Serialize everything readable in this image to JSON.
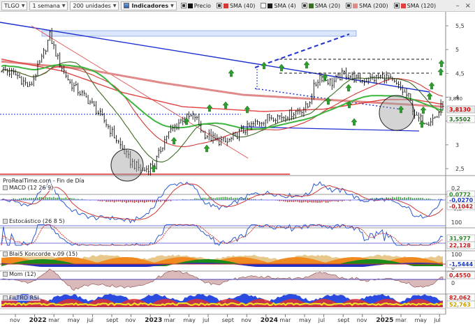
{
  "toolbar": {
    "symbol": "TLGO",
    "timeframe": "1 semana",
    "units": "200 unidades",
    "indicators_label": "Indicadores",
    "legend": [
      {
        "label": "Precio",
        "color": "#111111",
        "checked": true
      },
      {
        "label": "SMA (40)",
        "color": "#d23a3a",
        "checked": true
      },
      {
        "label": "SMA (4)",
        "color": "#1a1a1a",
        "checked": false
      },
      {
        "label": "SMA (20)",
        "color": "#3e6b25",
        "checked": true
      },
      {
        "label": "SMA (200)",
        "color": "#e08a8a",
        "checked": true
      },
      {
        "label": "SMA (120)",
        "color": "#e04040",
        "checked": true
      }
    ]
  },
  "main": {
    "watermark": "ProRealTime.com - Fin de Día",
    "price_axis": [
      "5,5",
      "5",
      "4,5",
      "4",
      "3,5",
      "3",
      "2,5"
    ],
    "last_price": "3,8130",
    "tag_upper": "3,880",
    "tag_sma": "3,5502",
    "x_axis": [
      "nov",
      "2022",
      "mar",
      "may",
      "jul",
      "sept",
      "nov",
      "2023",
      "mar",
      "may",
      "jul",
      "sept",
      "nov",
      "2024",
      "mar",
      "may",
      "jul",
      "sept",
      "nov",
      "2025",
      "mar",
      "may",
      "jul"
    ]
  },
  "macd": {
    "label": "MACD (12 26 9)",
    "axis": [
      "0,2",
      "-0,2"
    ],
    "v1": "0,0772",
    "v2": "-0,0270",
    "v3": "-0,1042"
  },
  "stoch": {
    "label": "Estocástico (26 8 5)",
    "axis": [
      "100",
      "0"
    ],
    "v1": "31,977",
    "v2": "22,128"
  },
  "blai": {
    "label": "Blai5 Koncorde v.09 (15)",
    "axis": [
      "100",
      "0"
    ],
    "v1": "-1,5444"
  },
  "mom": {
    "label": "Mom (12)",
    "axis": [
      "1",
      "0"
    ],
    "v1": "0,4550"
  },
  "rsi": {
    "label": "FILTRO RSI",
    "axis": [
      "50"
    ],
    "v1": "82,062",
    "v2": "52,763"
  },
  "colors": {
    "price": "#111111",
    "sma40": "#d23a3a",
    "sma20": "#3e6b25",
    "sma200": "#e08a8a",
    "sma120": "#e04040",
    "trend_blue": "#1c2fd1",
    "buy_arrow": "#2e9e2e",
    "last_price_bg": "#e8e8e8"
  }
}
